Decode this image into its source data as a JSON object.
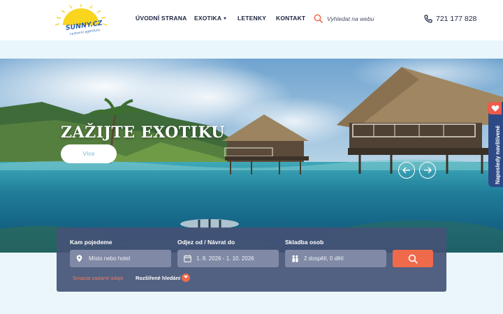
{
  "header": {
    "logo": {
      "brand": "SUNNY.CZ",
      "tagline": "cestovní agentura"
    },
    "nav": [
      {
        "label": "ÚVODNÍ STRANA"
      },
      {
        "label": "EXOTIKA",
        "has_dropdown": true
      },
      {
        "label": "LETENKY"
      },
      {
        "label": "KONTAKT"
      }
    ],
    "search": {
      "placeholder": "Vyhledat na webu",
      "icon": "search-icon"
    },
    "phone": {
      "number": "721 177 828",
      "icon": "phone-icon"
    }
  },
  "hero": {
    "title": "ZAŽIJTE EXOTIKU",
    "button_label": "Více",
    "prev_icon": "arrow-left-icon",
    "next_icon": "arrow-right-icon"
  },
  "side_tab": {
    "label": "Naposledy navštívené",
    "icon": "heart-icon"
  },
  "search_form": {
    "destination": {
      "label": "Kam pojedeme",
      "value": "Místo nebo hotel",
      "icon": "location-pin-icon"
    },
    "dates": {
      "label": "Odjez od / Návrat do",
      "value": "1. 8. 2026 - 1. 10. 2026",
      "icon": "calendar-icon"
    },
    "people": {
      "label": "Skladba osob",
      "value": "2 dospělí, 0 dětí",
      "icon": "people-icon"
    },
    "submit_icon": "search-icon",
    "clear_label": "Smazat zadané údaje",
    "advanced_label": "Rozšířené hledání"
  },
  "colors": {
    "accent": "#ef6a4b",
    "navy": "#1d2340",
    "panel": "#445276",
    "side_tab": "#2e4a86"
  }
}
